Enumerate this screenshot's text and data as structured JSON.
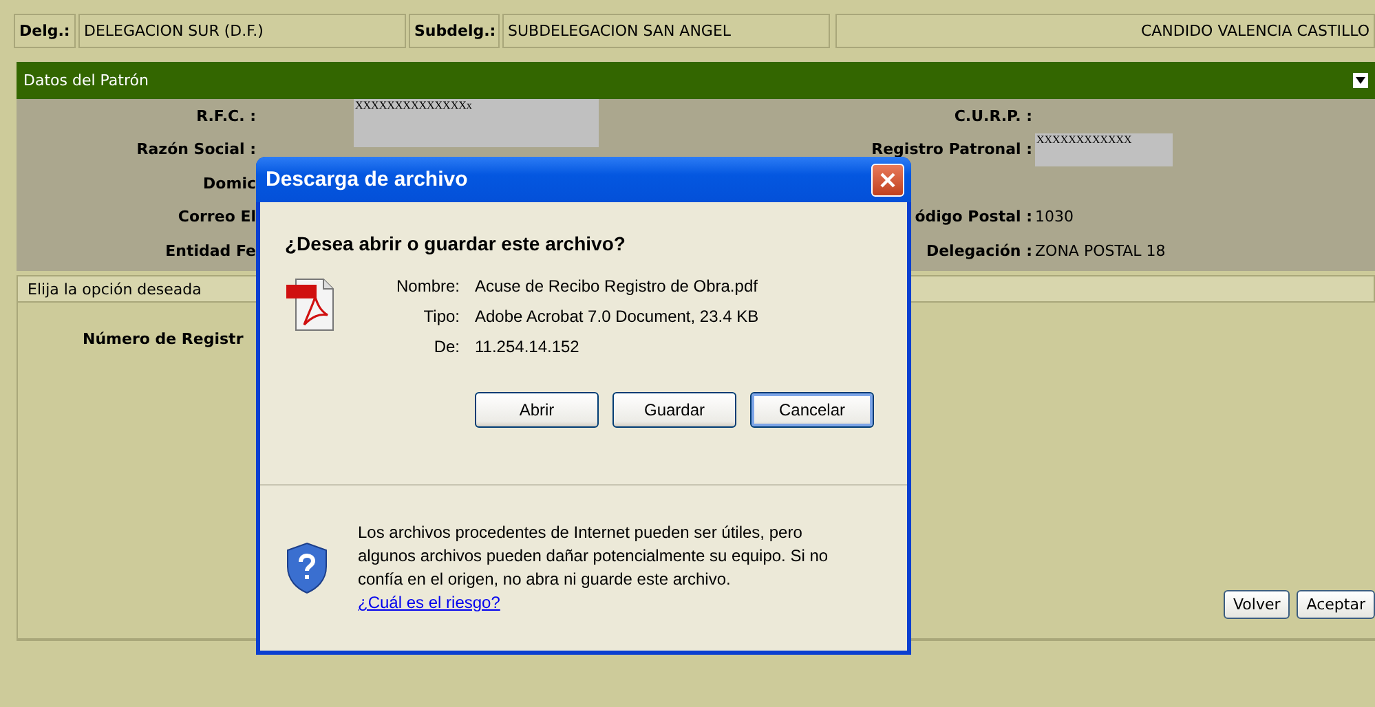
{
  "header": {
    "cells": [
      {
        "label": "Delg.:",
        "value": "DELEGACION SUR (D.F.)"
      },
      {
        "label": "Subdelg.:",
        "value": "SUBDELEGACION SAN ANGEL"
      }
    ],
    "user": "CANDIDO VALENCIA CASTILLO"
  },
  "section": {
    "title": "Datos del Patrón",
    "expanded": true
  },
  "rows": [
    {
      "left": {
        "label": "R.F.C. :",
        "value": "XXXXXXXXXXXXXXx"
      },
      "right": {
        "label": "C.U.R.P. :"
      }
    },
    {
      "left": {
        "label": "Razón Social :",
        "boxed": true
      },
      "right": {
        "label": "Registro Patronal :",
        "value": "XXXXXXXXXXXX"
      }
    },
    {
      "left": {
        "label": "Domic"
      }
    },
    {
      "left": {
        "label": "Correo El"
      },
      "right": {
        "label": "ódigo Postal :",
        "value": "1030"
      }
    },
    {
      "left": {
        "label": "Entidad Fe"
      },
      "right": {
        "label": "Delegación :",
        "value": "ZONA POSTAL 18"
      }
    }
  ],
  "options": {
    "title": "Elija la opción deseada",
    "field_label": "Número de Registr",
    "buttons": [
      "Volver",
      "Aceptar"
    ]
  },
  "dialog": {
    "title": "Descarga de archivo",
    "question": "¿Desea abrir o guardar este archivo?",
    "details": [
      {
        "label": "Nombre:",
        "value": "Acuse de Recibo Registro de Obra.pdf"
      },
      {
        "label": "Tipo:",
        "value": "Adobe Acrobat 7.0 Document, 23.4 KB"
      },
      {
        "label": "De:",
        "value": "11.254.14.152"
      }
    ],
    "buttons": [
      {
        "label": "Abrir",
        "focused": false
      },
      {
        "label": "Guardar",
        "focused": false
      },
      {
        "label": "Cancelar",
        "focused": true
      }
    ],
    "warning": "Los archivos procedentes de Internet pueden ser útiles, pero algunos archivos pueden dañar potencialmente su equipo. Si no confía en el origen, no abra ni guarde este archivo.",
    "link": "¿Cuál es el riesgo?"
  }
}
